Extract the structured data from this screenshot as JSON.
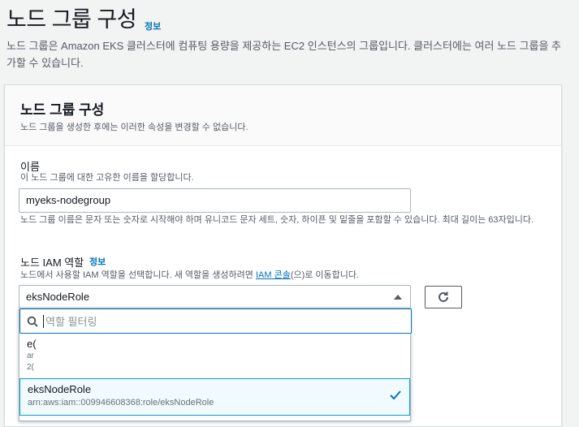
{
  "header": {
    "title": "노드 그룹 구성",
    "info": "정보",
    "description": "노드 그룹은 Amazon EKS 클러스터에 컴퓨팅 용량을 제공하는 EC2 인스턴스의 그룹입니다. 클러스터에는 여러 노드 그룹을 추가할 수 있습니다."
  },
  "panel": {
    "title": "노드 그룹 구성",
    "subtitle": "노드 그룹을 생성한 후에는 이러한 속성을 변경할 수 없습니다."
  },
  "name_field": {
    "label": "이름",
    "hint": "이 노드 그룹에 대한 고유한 이름을 할당합니다.",
    "value": "myeks-nodegroup",
    "constraint": "노드 그룹 이름은 문자 또는 숫자로 시작해야 하며 유니코드 문자 세트, 숫자, 하이픈 및 밑줄을 포함할 수 있습니다. 최대 길이는 63자입니다."
  },
  "role_field": {
    "label": "노드 IAM 역할",
    "info": "정보",
    "hint_before": "노드에서 사용할 IAM 역할을 선택합니다. 새 역할을 생성하려면 ",
    "hint_link": "IAM 콘솔",
    "hint_after": "(으)로 이동합니다.",
    "selected": "eksNodeRole"
  },
  "dropdown": {
    "filter_placeholder": "역할 필터링",
    "options": [
      {
        "label": "e(",
        "line2": "ar",
        "line3": "2("
      },
      {
        "label": "eksNodeRole",
        "arn": "arn:aws:iam::009946608368:role/eksNodeRole"
      }
    ]
  },
  "icons": {
    "title_info": "info-link",
    "refresh": "refresh-icon",
    "search": "search-icon",
    "caret": "caret-up-icon",
    "check": "check-icon"
  },
  "colors": {
    "accent": "#0073bb",
    "selected_bg": "#f1faff",
    "selected_border": "#00a1c9"
  }
}
